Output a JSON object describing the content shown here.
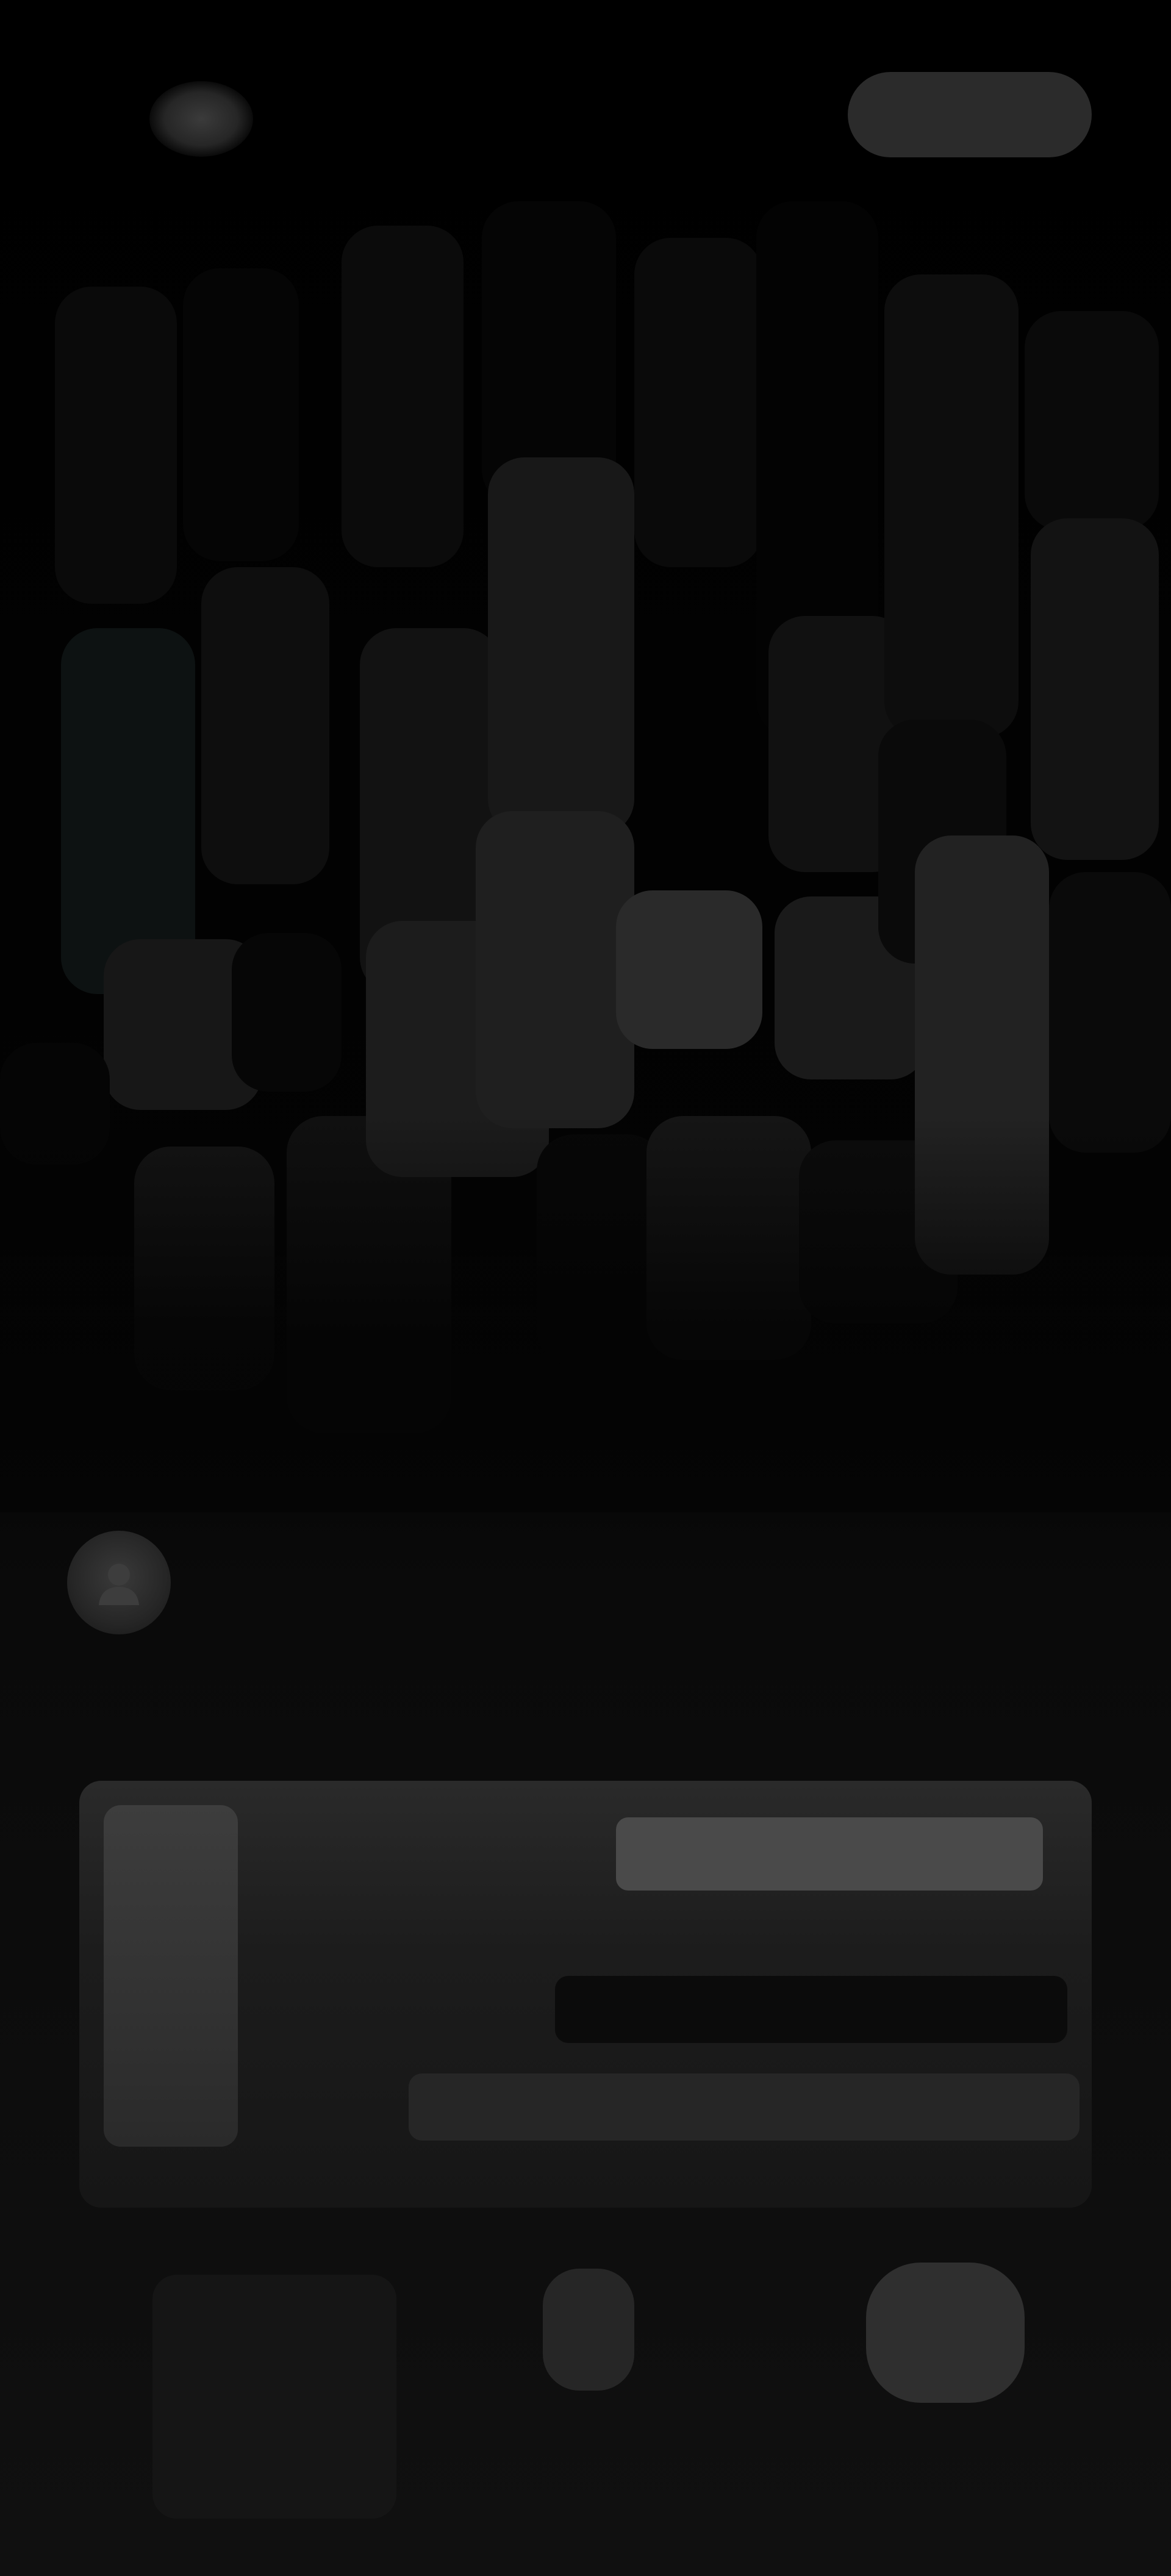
{
  "header": {
    "logo_icon": "brand-logo-icon",
    "cta_label": ""
  },
  "hero": {
    "description": "",
    "colors": {
      "background": "#000000",
      "tile_dark": "#0c0c0c",
      "tile_mid": "#1b1b1b",
      "tile_light": "#2a2a2a",
      "tile_teal": "#0f1616"
    }
  },
  "intro": {
    "icon": "user-avatar-icon",
    "heading": "",
    "subheading": ""
  },
  "card": {
    "title": "",
    "strip_text": "",
    "caption": ""
  },
  "bottom": {
    "icon": "app-icon",
    "button_label": ""
  }
}
